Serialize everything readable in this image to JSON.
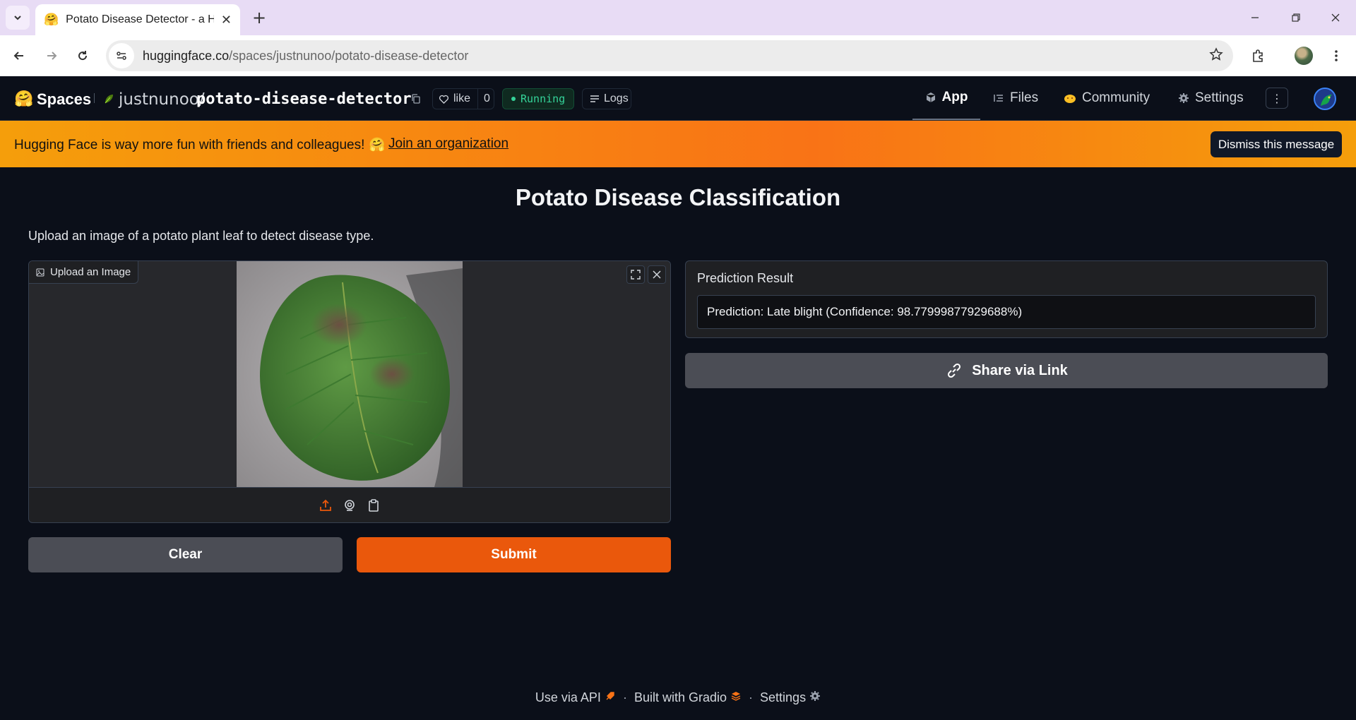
{
  "browser": {
    "tab_title": "Potato Disease Detector - a Hug",
    "tab_favicon": "🤗",
    "url_host": "huggingface.co",
    "url_path": "/spaces/justnunoo/potato-disease-detector"
  },
  "hf_header": {
    "logo": "🤗",
    "spaces_label": "Spaces",
    "owner": "justnunoo",
    "separator": "/",
    "repo": "potato-disease-detector",
    "like_label": "like",
    "like_count": "0",
    "status": "Running",
    "logs_label": "Logs",
    "nav": {
      "app": "App",
      "files": "Files",
      "community": "Community",
      "settings": "Settings"
    }
  },
  "banner": {
    "message": "Hugging Face is way more fun with friends and colleagues!",
    "emoji": "🤗",
    "link": "Join an organization",
    "dismiss": "Dismiss this message"
  },
  "app": {
    "title": "Potato Disease Classification",
    "description": "Upload an image of a potato plant leaf to detect disease type.",
    "image_label": "Upload an Image",
    "clear_label": "Clear",
    "submit_label": "Submit",
    "result_label": "Prediction Result",
    "result_value": "Prediction: Late blight (Confidence: 98.77999877929688%)",
    "share_label": "Share via Link"
  },
  "footer": {
    "api": "Use via API",
    "built": "Built with Gradio",
    "settings": "Settings",
    "dot": "·"
  },
  "colors": {
    "accent": "#ea580c",
    "banner": "#f59e0b",
    "running": "#34d399",
    "background": "#0b0f19"
  }
}
